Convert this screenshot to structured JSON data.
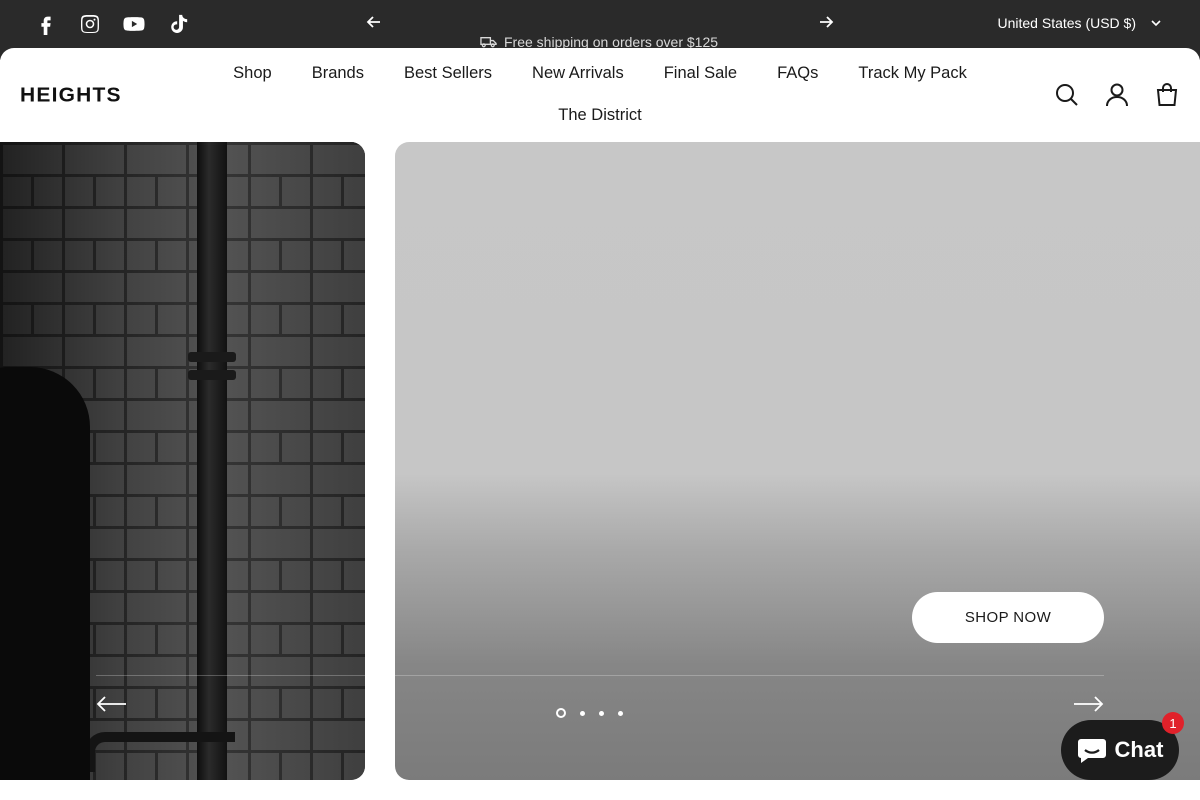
{
  "announcement": {
    "message": "Free shipping on orders over $125",
    "currency_label": "United States (USD $)",
    "social_icons": [
      "facebook-icon",
      "instagram-icon",
      "youtube-icon",
      "tiktok-icon"
    ]
  },
  "header": {
    "logo_text": "HEIGHTS",
    "nav": [
      "Shop",
      "Brands",
      "Best Sellers",
      "New Arrivals",
      "Final Sale",
      "FAQs",
      "Track My Pack",
      "The District"
    ],
    "icons": [
      "search-icon",
      "account-icon",
      "cart-icon"
    ]
  },
  "hero": {
    "cta_label": "SHOP NOW",
    "slide_count": 4,
    "active_slide": 1
  },
  "chat": {
    "label": "Chat",
    "badge": "1"
  },
  "colors": {
    "bar_bg": "#2a2a2a",
    "accent_badge": "#e0212a",
    "chat_bg": "#1c1c1c"
  }
}
